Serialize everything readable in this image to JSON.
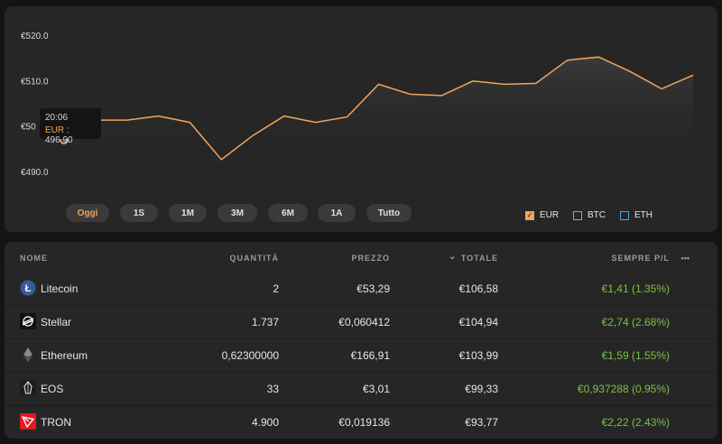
{
  "chart": {
    "tooltip": {
      "time": "20:06",
      "currency": "EUR",
      "separator": " : ",
      "value": "496,90"
    },
    "ranges": [
      {
        "label": "Oggi",
        "active": true
      },
      {
        "label": "1S",
        "active": false
      },
      {
        "label": "1M",
        "active": false
      },
      {
        "label": "3M",
        "active": false
      },
      {
        "label": "6M",
        "active": false
      },
      {
        "label": "1A",
        "active": false
      },
      {
        "label": "Tutto",
        "active": false
      }
    ],
    "legend": [
      {
        "label": "EUR",
        "color": "#f0a45d",
        "checked": true
      },
      {
        "label": "BTC",
        "color": "#7cc043",
        "checked": false
      },
      {
        "label": "ETH",
        "color": "#4aa3df",
        "checked": false
      }
    ],
    "line_color": "#f0a45d"
  },
  "chart_data": {
    "type": "area",
    "y_tick_labels": [
      "€520.0",
      "€510.0",
      "€50",
      "€490.0"
    ],
    "ylim": [
      488,
      523
    ],
    "x": [
      0,
      1,
      2,
      3,
      4,
      5,
      6,
      7,
      8,
      9,
      10,
      11,
      12,
      13,
      14,
      15,
      16,
      17,
      18,
      19,
      20,
      21,
      22,
      23
    ],
    "series": [
      {
        "values": [
          496.9,
          501.3,
          501.3,
          502.2,
          500.8,
          492.6,
          497.9,
          502.2,
          500.8,
          502.0,
          509.2,
          507.0,
          506.7,
          509.9,
          509.2,
          509.4,
          514.5,
          515.2,
          512.0,
          508.2,
          511.2
        ]
      }
    ]
  },
  "table": {
    "headers": {
      "name": "NOME",
      "quantity": "QUANTITÀ",
      "price": "PREZZO",
      "total": "TOTALE",
      "pl": "SEMPRE P/L",
      "more": "•••"
    },
    "rows": [
      {
        "name": "Litecoin",
        "icon": "litecoin-icon",
        "quantity": "2",
        "price": "€53,29",
        "total": "€106,58",
        "pl": "€1,41 (1.35%)"
      },
      {
        "name": "Stellar",
        "icon": "stellar-icon",
        "quantity": "1.737",
        "price": "€0,060412",
        "total": "€104,94",
        "pl": "€2,74 (2.68%)"
      },
      {
        "name": "Ethereum",
        "icon": "ethereum-icon",
        "quantity": "0,62300000",
        "price": "€166,91",
        "total": "€103,99",
        "pl": "€1,59 (1.55%)"
      },
      {
        "name": "EOS",
        "icon": "eos-icon",
        "quantity": "33",
        "price": "€3,01",
        "total": "€99,33",
        "pl": "€0,937288 (0.95%)"
      },
      {
        "name": "TRON",
        "icon": "tron-icon",
        "quantity": "4.900",
        "price": "€0,019136",
        "total": "€93,77",
        "pl": "€2,22 (2.43%)"
      }
    ]
  }
}
